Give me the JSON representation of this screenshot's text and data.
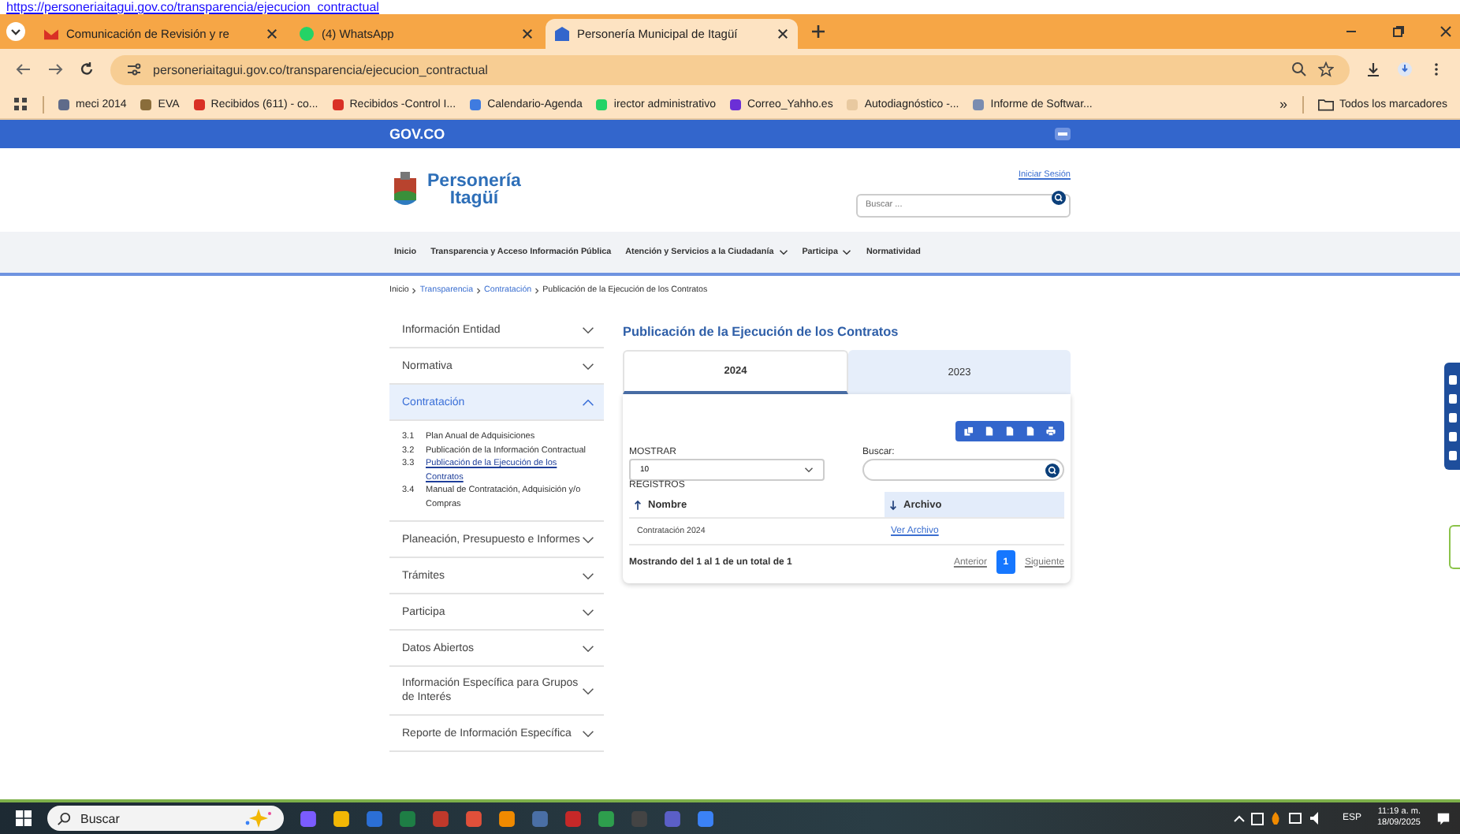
{
  "url_banner": "https://personeriaitagui.gov.co/transparencia/ejecucion_contractual",
  "browser": {
    "tabs": [
      {
        "title": "Comunicación de Revisión y re",
        "kind": "gmail",
        "selected": false
      },
      {
        "title": "(4) WhatsApp",
        "kind": "whatsapp",
        "selected": false
      },
      {
        "title": "Personería Municipal de Itagüí",
        "kind": "site",
        "selected": true
      }
    ],
    "address": "personeriaitagui.gov.co/transparencia/ejecucion_contractual",
    "bookmarks": [
      {
        "label": "meci 2014",
        "kind": "shield"
      },
      {
        "label": "EVA",
        "kind": "person"
      },
      {
        "label": "Recibidos (611) - co...",
        "kind": "gmail"
      },
      {
        "label": "Recibidos -Control I...",
        "kind": "gmail"
      },
      {
        "label": "Calendario-Agenda",
        "kind": "calendar"
      },
      {
        "label": "irector administrativo",
        "kind": "whatsapp"
      },
      {
        "label": "Correo_Yahho.es",
        "kind": "mail"
      },
      {
        "label": "Autodiagnóstico -...",
        "kind": "page"
      },
      {
        "label": "Informe de Softwar...",
        "kind": "globe"
      }
    ],
    "overflow": "»",
    "all_bookmarks": "Todos los marcadores"
  },
  "gov_bar": {
    "logo": "GOV.CO"
  },
  "header": {
    "brand_line1": "Personería",
    "brand_line2": "Itagüí",
    "login": "Iniciar Sesión",
    "search_placeholder": "Buscar ..."
  },
  "nav": [
    {
      "label": "Inicio",
      "dropdown": false
    },
    {
      "label": "Transparencia y Acceso Información Pública",
      "dropdown": false
    },
    {
      "label": "Atención y Servicios a la Ciudadanía",
      "dropdown": true
    },
    {
      "label": "Participa",
      "dropdown": true
    },
    {
      "label": "Normatividad",
      "dropdown": false
    }
  ],
  "breadcrumb": [
    "Inicio",
    "Transparencia",
    "Contratación",
    "Publicación de la Ejecución de los Contratos"
  ],
  "sidebar": [
    {
      "label": "Información Entidad",
      "expanded": false
    },
    {
      "label": "Normativa",
      "expanded": false
    },
    {
      "label": "Contratación",
      "expanded": true,
      "children": [
        {
          "number": "3.1",
          "label": "Plan Anual de Adquisiciones",
          "selected": false
        },
        {
          "number": "3.2",
          "label": "Publicación de la Información Contractual",
          "selected": false
        },
        {
          "number": "3.3",
          "label": "Publicación de la Ejecución de los Contratos",
          "selected": true
        },
        {
          "number": "3.4",
          "label": "Manual de Contratación, Adquisición y/o Compras",
          "selected": false
        }
      ]
    },
    {
      "label": "Planeación, Presupuesto e Informes",
      "expanded": false
    },
    {
      "label": "Trámites",
      "expanded": false
    },
    {
      "label": "Participa",
      "expanded": false
    },
    {
      "label": "Datos Abiertos",
      "expanded": false
    },
    {
      "label": "Información Específica para Grupos de Interés",
      "expanded": false
    },
    {
      "label": "Reporte de Información Específica",
      "expanded": false
    }
  ],
  "content": {
    "title": "Publicación de la Ejecución de los Contratos",
    "tabs": [
      {
        "label": "2024",
        "selected": true
      },
      {
        "label": "2023",
        "selected": false
      }
    ],
    "show_label": "MOSTRAR",
    "show_value": "10",
    "search_label": "Buscar:",
    "records_label": "REGISTROS",
    "columns": [
      "Nombre",
      "Archivo"
    ],
    "rows": [
      {
        "name": "Contratación 2024",
        "file": "Ver Archivo"
      }
    ],
    "summary": "Mostrando del 1 al 1 de un total de 1",
    "pagination": {
      "prev": "Anterior",
      "pages": [
        {
          "label": "1",
          "selected": true
        }
      ],
      "next": "Siguiente"
    }
  },
  "taskbar": {
    "search_placeholder": "Buscar",
    "language": "ESP",
    "time": "11:19 a. m.",
    "date": "18/09/2025"
  }
}
